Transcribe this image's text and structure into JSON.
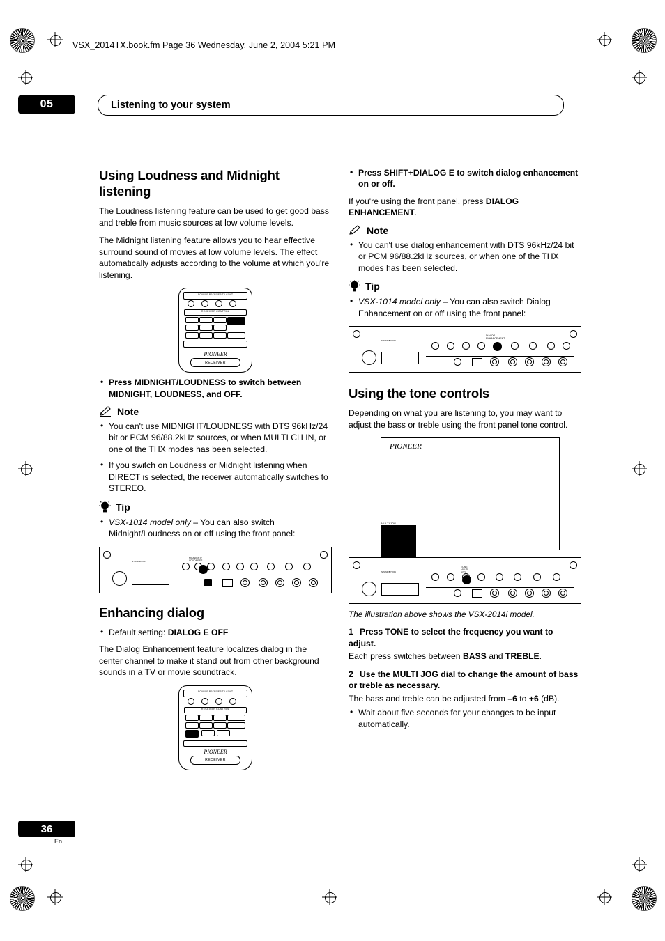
{
  "header": {
    "file_line": "VSX_2014TX.book.fm  Page 36  Wednesday, June 2, 2004  5:21 PM",
    "chapter_number": "05",
    "chapter_title": "Listening to your system"
  },
  "left_column": {
    "section1": {
      "title": "Using Loudness and Midnight listening",
      "p1": "The Loudness listening feature can be used to get good bass and treble from music sources at low volume levels.",
      "p2": "The Midnight listening feature allows you to hear effective surround sound of movies at low volume levels. The effect automatically adjusts according to the volume at which you're listening.",
      "bullet1": "Press MIDNIGHT/LOUDNESS to switch between MIDNIGHT, LOUDNESS, and OFF.",
      "note_label": "Note",
      "note_items": [
        "You can't use MIDNIGHT/LOUDNESS with DTS 96kHz/24 bit or PCM 96/88.2kHz sources, or when MULTI CH IN, or one of the THX modes has been selected.",
        "If you switch on Loudness or Midnight listening when DIRECT is selected, the receiver automatically switches to STEREO."
      ],
      "tip_label": "Tip",
      "tip_item": "VSX-1014 model only – You can also switch Midnight/Loudness on or off using the front panel:"
    },
    "section2": {
      "title": "Enhancing dialog",
      "default_setting": "Default setting: DIALOG E OFF",
      "p1": "The Dialog Enhancement feature localizes dialog in the center channel to make it stand out from other background sounds in a TV or movie soundtrack."
    }
  },
  "right_column": {
    "bullet1": "Press SHIFT+DIALOG E to switch dialog enhancement on or off.",
    "p_after_bullet": "If you're using the front panel, press DIALOG ENHANCEMENT.",
    "note_label": "Note",
    "note_items": [
      "You can't use dialog enhancement with DTS 96kHz/24 bit or PCM 96/88.2kHz sources, or when one of the THX modes has been selected."
    ],
    "tip_label": "Tip",
    "tip_item": "VSX-1014 model only – You can also switch Dialog Enhancement on or off using the front panel:",
    "section_tone": {
      "title": "Using the tone controls",
      "p1": "Depending on what you are listening to, you may want to adjust the bass or treble using the front panel tone control.",
      "caption": "The illustration above shows the VSX-2014i model.",
      "step1_num": "1",
      "step1": "Press TONE to select the frequency you want to adjust.",
      "step1_body": "Each press switches between BASS and TREBLE.",
      "step2_num": "2",
      "step2": "Use the MULTI JOG dial to change the amount of bass or treble as necessary.",
      "step2_body": "The bass and treble can be adjusted from –6 to +6 (dB).",
      "step2_bullet": "Wait about five seconds for your changes to be input automatically."
    }
  },
  "illustrations": {
    "remote_top": {
      "receiver_control": "RECEIVER CONTROL",
      "highlight_button": "MIDNIGHT/ LOUDNESS",
      "brand": "PIONEER",
      "receiver_tag": "RECEIVER"
    },
    "remote_bottom": {
      "receiver_control": "RECEIVER CONTROL",
      "brand": "PIONEER",
      "receiver_tag": "RECEIVER"
    },
    "panel_left": {
      "highlight_label": "MIDNIGHT/ LOUDNESS"
    },
    "panel_right_top": {
      "highlight_label": "DIALOG ENHANCEMENT"
    },
    "panel_right_bottom": {
      "highlight_label": "TONE / MULTI JOG"
    },
    "receiver_front": {
      "brand": "PIONEER"
    }
  },
  "footer": {
    "page_number": "36",
    "language": "En"
  },
  "colors": {
    "ink": "#000000",
    "paper": "#ffffff"
  }
}
